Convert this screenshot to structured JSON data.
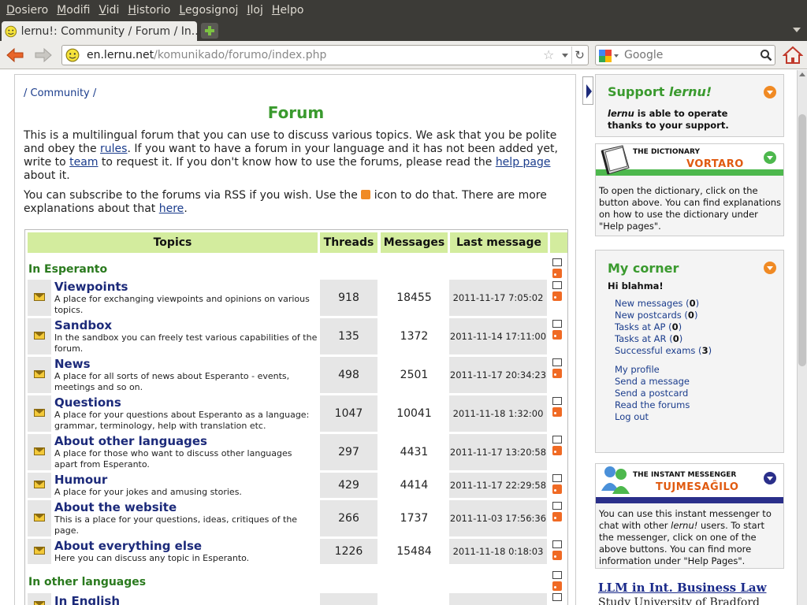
{
  "menubar": {
    "items": [
      {
        "label": "Dosiero"
      },
      {
        "label": "Modifi"
      },
      {
        "label": "Vidi"
      },
      {
        "label": "Historio"
      },
      {
        "label": "Legosignoj"
      },
      {
        "label": "Iloj"
      },
      {
        "label": "Helpo"
      }
    ]
  },
  "tab": {
    "title": "lernu!: Community / Forum / In..."
  },
  "navbar": {
    "url_host": "en.lernu.net",
    "url_path": "/komunikado/forumo/index.php",
    "search_placeholder": "Google"
  },
  "page": {
    "breadcrumb": "/ Community /",
    "title": "Forum",
    "intro": {
      "p1_a": "This is a multilingual forum that you can use to discuss various topics. We ask that you be polite and obey the ",
      "p1_rules": "rules",
      "p1_b": ". If you want to have a forum in your language and it has not been added yet, write to ",
      "p1_team": "team",
      "p1_c": " to request it. If you don't know how to use the forums, please read the ",
      "p1_help": "help page",
      "p1_d": " about it.",
      "p2_a": "You can subscribe to the forums via RSS if you wish. Use the ",
      "p2_b": " icon to do that. There are more explanations about that ",
      "p2_here": "here",
      "p2_c": "."
    },
    "table": {
      "headers": {
        "topics": "Topics",
        "threads": "Threads",
        "messages": "Messages",
        "last": "Last message"
      },
      "section_esperanto": "In Esperanto",
      "section_other": "In other languages",
      "forums": [
        {
          "name": "Viewpoints",
          "desc": "A place for exchanging viewpoints and opinions on various topics.",
          "threads": "918",
          "messages": "18455",
          "last": "2011-11-17 7:05:02"
        },
        {
          "name": "Sandbox",
          "desc": "In the sandbox you can freely test various capabilities of the forum.",
          "threads": "135",
          "messages": "1372",
          "last": "2011-11-14 17:11:00"
        },
        {
          "name": "News",
          "desc": "A place for all sorts of news about Esperanto - events, meetings and so on.",
          "threads": "498",
          "messages": "2501",
          "last": "2011-11-17 20:34:23"
        },
        {
          "name": "Questions",
          "desc": "A place for your questions about Esperanto as a language: grammar, terminology, help with translation etc.",
          "threads": "1047",
          "messages": "10041",
          "last": "2011-11-18 1:32:00"
        },
        {
          "name": "About other languages",
          "desc": "A place for those who want to discuss other languages apart from Esperanto.",
          "threads": "297",
          "messages": "4431",
          "last": "2011-11-17 13:20:58"
        },
        {
          "name": "Humour",
          "desc": "A place for your jokes and amusing stories.",
          "threads": "429",
          "messages": "4414",
          "last": "2011-11-17 22:29:58"
        },
        {
          "name": "About the website",
          "desc": "This is a place for your questions, ideas, critiques of the page.",
          "threads": "266",
          "messages": "1737",
          "last": "2011-11-03 17:56:36"
        },
        {
          "name": "About everything else",
          "desc": "Here you can discuss any topic in Esperanto.",
          "threads": "1226",
          "messages": "15484",
          "last": "2011-11-18 0:18:03"
        }
      ],
      "other_first": {
        "name": "In English"
      }
    }
  },
  "sidebar": {
    "support": {
      "title_a": "Support ",
      "title_b": "lernu!",
      "text_brand": "lernu",
      "text": " is able to operate thanks to your support."
    },
    "dictionary": {
      "label": "THE DICTIONARY",
      "name": "VORTARO",
      "text": "To open the dictionary, click on the button above. You can find explanations on how to use the dictionary under \"Help pages\"."
    },
    "corner": {
      "title": "My corner",
      "greeting": "Hi blahma!",
      "stats": [
        {
          "label": "New messages",
          "count": "0"
        },
        {
          "label": "New postcards",
          "count": "0"
        },
        {
          "label": "Tasks at AP",
          "count": "0"
        },
        {
          "label": "Tasks at AR",
          "count": "0"
        },
        {
          "label": "Successful exams",
          "count": "3"
        }
      ],
      "links": [
        "My profile",
        "Send a message",
        "Send a postcard",
        "Read the forums",
        "Log out"
      ]
    },
    "messenger": {
      "label": "THE INSTANT MESSENGER",
      "name": "TUJMESAĜILO",
      "text_a": "You can use this instant messenger to chat with other ",
      "text_brand": "lernu!",
      "text_b": " users. To start the messenger, click on one of the above buttons. You can find more information under \"Help Pages\"."
    },
    "ad": {
      "title": "LLM in Int. Business Law",
      "sub": "Study University of Bradford"
    }
  },
  "colors": {
    "accent_green": "#3a9a2e",
    "header_green": "#d3ec9e",
    "link_blue": "#1a3c8c",
    "orange": "#f08a24"
  }
}
